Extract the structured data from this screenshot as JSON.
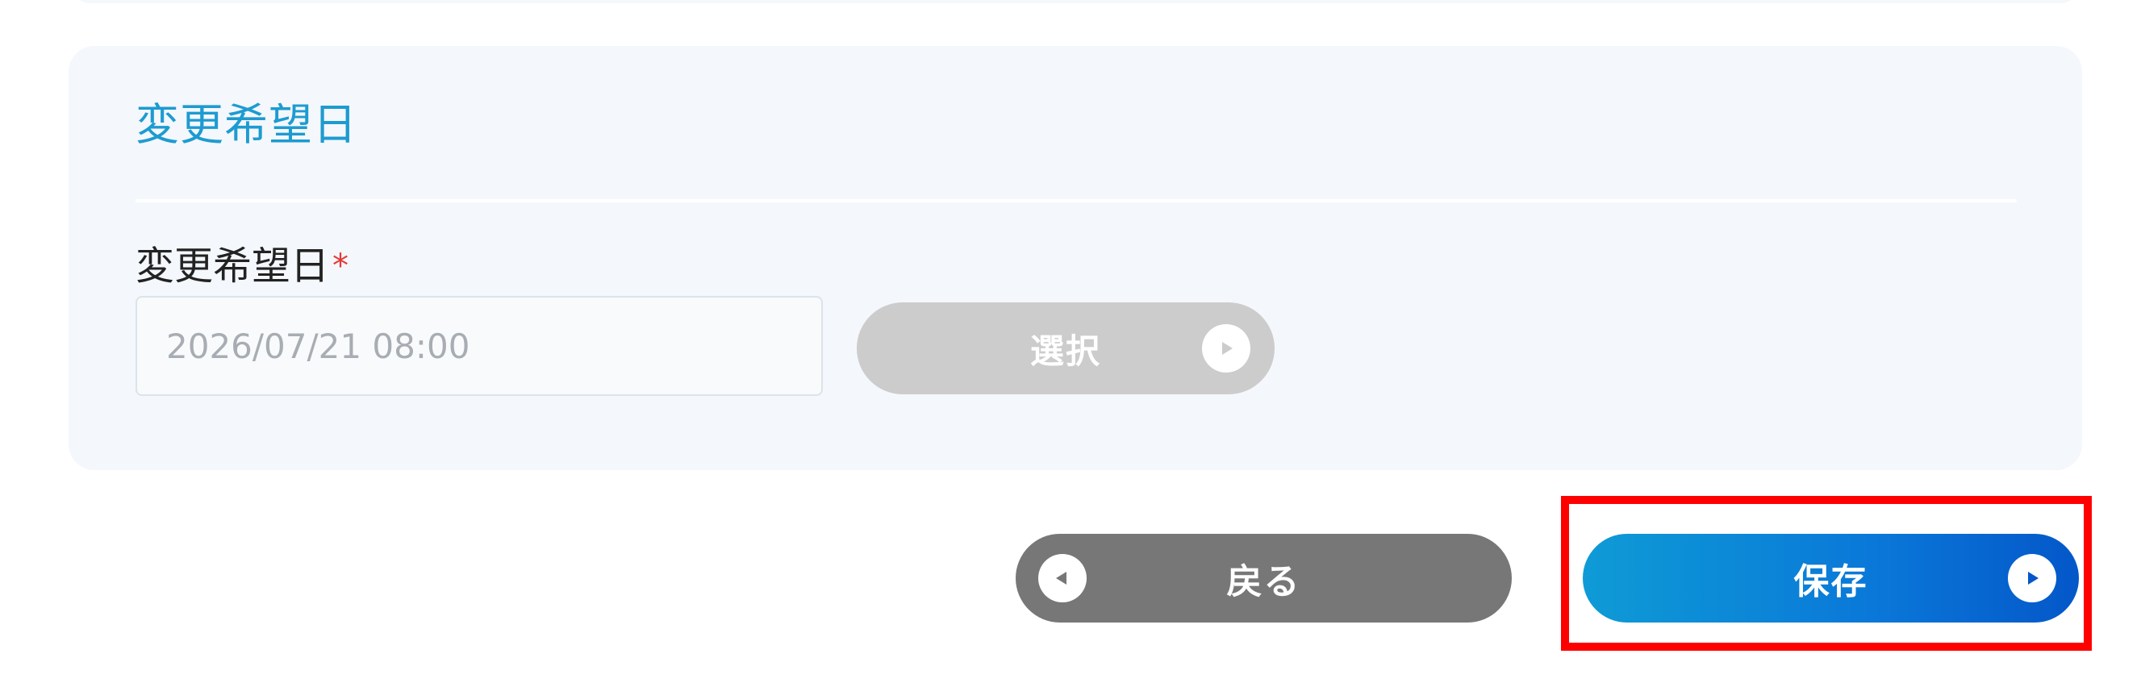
{
  "section": {
    "title": "変更希望日"
  },
  "field": {
    "label": "変更希望日",
    "required_mark": "*",
    "placeholder": "2026/07/21 08:00"
  },
  "buttons": {
    "select_label": "選択",
    "back_label": "戻る",
    "save_label": "保存"
  },
  "icons": {
    "select_icon": "play-circle-icon",
    "back_icon": "back-circle-icon",
    "save_icon": "play-circle-icon"
  },
  "colors": {
    "title_accent": "#1d9bd1",
    "required": "#e53935",
    "save_gradient_start": "#0e9bd6",
    "save_gradient_end": "#0457c9",
    "back_button": "#777777",
    "select_button_disabled": "#cccccc",
    "highlight_box": "#ff0000"
  }
}
